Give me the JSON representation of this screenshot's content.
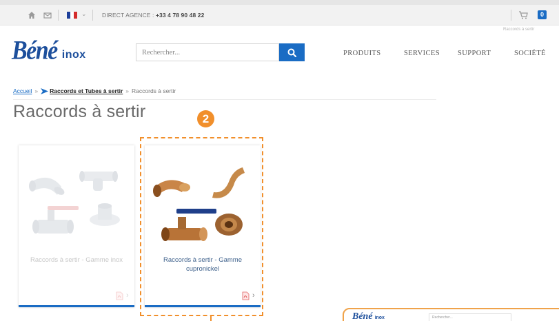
{
  "topbar": {
    "direct_label": "DIRECT AGENCE : ",
    "direct_phone": "+33 4 78 90 48 22",
    "cart_count": "0",
    "mini_breadcrumb": "Raccords à sertir"
  },
  "header": {
    "logo_main": "Béné",
    "logo_sub": "inox",
    "search_placeholder": "Rechercher...",
    "nav": [
      "PRODUITS",
      "SERVICES",
      "SUPPORT",
      "SOCIÉTÉ"
    ]
  },
  "breadcrumb": {
    "home": "Accueil",
    "separator": "»",
    "parent": "Raccords et Tubes à sertir",
    "current": "Raccords à sertir"
  },
  "page_title": "Raccords à sertir",
  "annotation": {
    "step": "2",
    "color": "#f18f2b"
  },
  "cards": [
    {
      "label": "Raccords à sertir - Gamme inox",
      "icon": "pdf-icon"
    },
    {
      "label": "Raccords à sertir - Gamme cupronickel",
      "icon": "pdf-icon"
    }
  ],
  "thumbnail": {
    "logo_main": "Béné",
    "logo_sub": "inox",
    "search_placeholder": "Rechercher..."
  },
  "colors": {
    "brand_blue": "#1d4f9c",
    "accent_blue": "#1a6cc4",
    "annotation_orange": "#f18f2b"
  }
}
